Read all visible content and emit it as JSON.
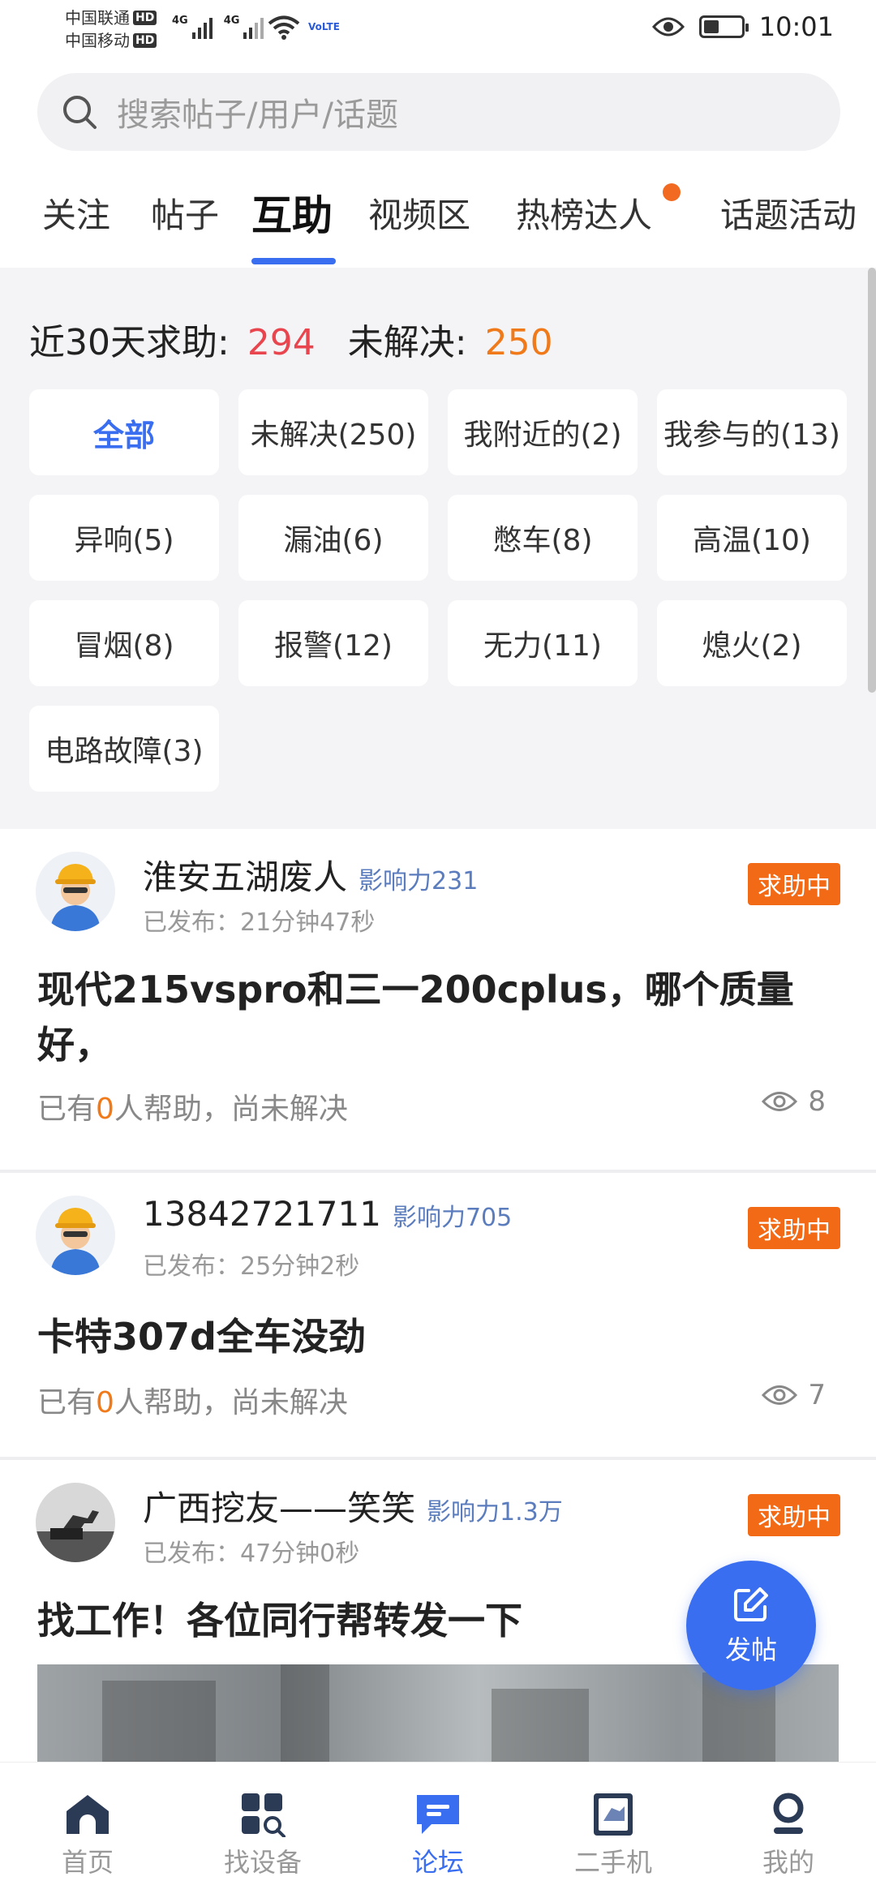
{
  "status_bar": {
    "carrier1": "中国联通",
    "carrier2": "中国移动",
    "hd": "HD",
    "network": "4G",
    "volte": "VoLTE",
    "time": "10:01"
  },
  "search": {
    "placeholder": "搜索帖子/用户/话题",
    "icon": "search-icon"
  },
  "tabs": [
    {
      "label": "关注"
    },
    {
      "label": "帖子"
    },
    {
      "label": "互助",
      "active": true
    },
    {
      "label": "视频区"
    },
    {
      "label": "热榜达人",
      "has_dot": true
    },
    {
      "label": "话题活动"
    }
  ],
  "help_stats": {
    "recent_label": "近30天求助:",
    "recent_count": "294",
    "unsolved_label": "未解决:",
    "unsolved_count": "250"
  },
  "filters": [
    "全部",
    "未解决(250)",
    "我附近的(2)",
    "我参与的(13)",
    "异响(5)",
    "漏油(6)",
    "憋车(8)",
    "高温(10)",
    "冒烟(8)",
    "报警(12)",
    "无力(11)",
    "熄火(2)",
    "电路故障(3)"
  ],
  "posts": [
    {
      "user": "淮安五湖废人",
      "influence": "影响力231",
      "published": "已发布：21分钟47秒",
      "status": "求助中",
      "title": "现代215vspro和三一200cplus，哪个质量好，",
      "helped_prefix": "已有",
      "helped_count": "0",
      "helped_suffix": "人帮助，尚未解决",
      "views": "8"
    },
    {
      "user": "13842721711",
      "influence": "影响力705",
      "published": "已发布：25分钟2秒",
      "status": "求助中",
      "title": "卡特307d全车没劲",
      "helped_prefix": "已有",
      "helped_count": "0",
      "helped_suffix": "人帮助，尚未解决",
      "views": "7"
    },
    {
      "user": "广西挖友——笑笑",
      "influence": "影响力1.3万",
      "published": "已发布：47分钟0秒",
      "status": "求助中",
      "title": "找工作！各位同行帮转发一下"
    }
  ],
  "fab": {
    "label": "发帖",
    "icon": "edit-icon"
  },
  "bottom_nav": [
    {
      "label": "首页",
      "icon": "home-icon"
    },
    {
      "label": "找设备",
      "icon": "grid-search-icon"
    },
    {
      "label": "论坛",
      "icon": "forum-icon",
      "active": true
    },
    {
      "label": "二手机",
      "icon": "used-machine-icon"
    },
    {
      "label": "我的",
      "icon": "profile-icon"
    }
  ],
  "colors": {
    "accent": "#3a6ef0",
    "badge": "#f26a16",
    "red_count": "#e8454e",
    "orange_count": "#f07a1a",
    "influence": "#5b7cbd"
  }
}
